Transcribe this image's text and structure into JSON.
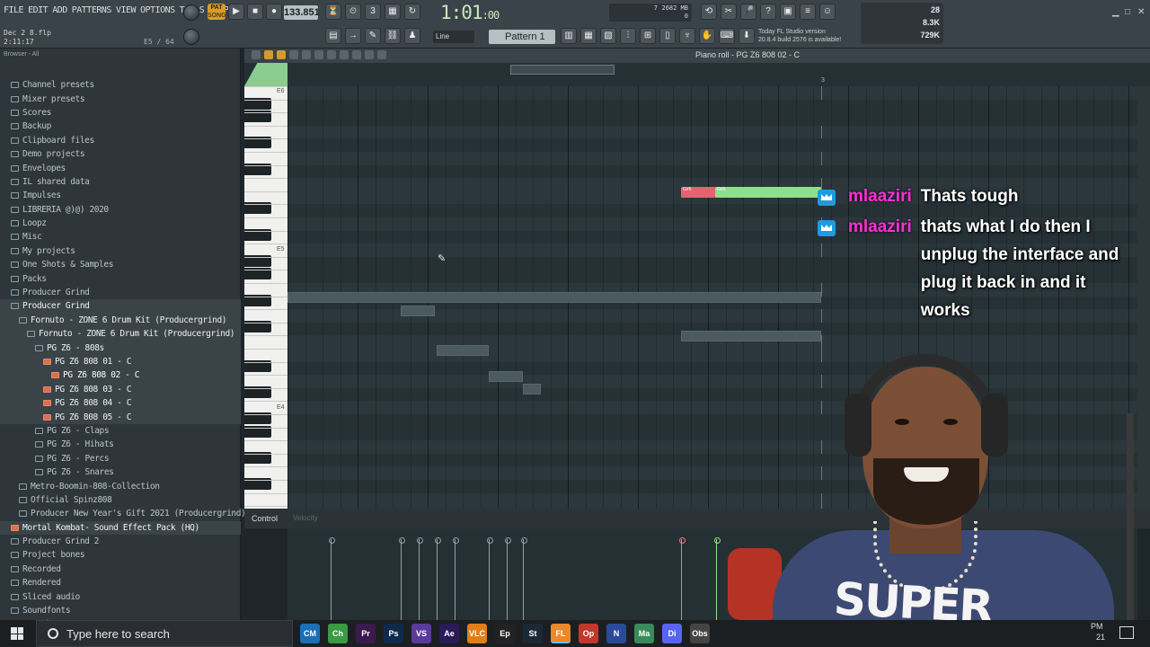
{
  "menu": [
    "FILE",
    "EDIT",
    "ADD",
    "PATTERNS",
    "VIEW",
    "OPTIONS",
    "TOOLS",
    "HELP"
  ],
  "project": {
    "file": "Dec 2 8.flp",
    "time": "2:11:17",
    "hint_pos": "E5 / 64"
  },
  "transport": {
    "pat_label": "PAT",
    "song_label": "SONG",
    "tempo": "133.851",
    "time": "1:01",
    "time_small": ":00",
    "bst_label": "B:S:T"
  },
  "cpu": {
    "value": "7",
    "mem": "2682 MB",
    "poly": "0"
  },
  "snap": {
    "label": "Line"
  },
  "pattern": {
    "label": "Pattern 1"
  },
  "news": {
    "line1": "Today  FL Studio version",
    "line2": "20.8.4 build 2576 is available!"
  },
  "stats": {
    "a": "28",
    "b": "8.3K",
    "c": "729K"
  },
  "browser": {
    "header": "Browser - All",
    "items": [
      {
        "label": "Channel presets",
        "indent": 0,
        "type": "folder"
      },
      {
        "label": "Mixer presets",
        "indent": 0,
        "type": "folder"
      },
      {
        "label": "Scores",
        "indent": 0,
        "type": "folder"
      },
      {
        "label": "Backup",
        "indent": 0,
        "type": "folder"
      },
      {
        "label": "Clipboard files",
        "indent": 0,
        "type": "folder"
      },
      {
        "label": "Demo projects",
        "indent": 0,
        "type": "folder"
      },
      {
        "label": "Envelopes",
        "indent": 0,
        "type": "folder"
      },
      {
        "label": "IL shared data",
        "indent": 0,
        "type": "folder"
      },
      {
        "label": "Impulses",
        "indent": 0,
        "type": "folder"
      },
      {
        "label": "LIBRERIA @)@) 2020",
        "indent": 0,
        "type": "folder"
      },
      {
        "label": "Loopz",
        "indent": 0,
        "type": "folder"
      },
      {
        "label": "Misc",
        "indent": 0,
        "type": "folder"
      },
      {
        "label": "My projects",
        "indent": 0,
        "type": "folder"
      },
      {
        "label": "One Shots & Samples",
        "indent": 0,
        "type": "folder"
      },
      {
        "label": "Packs",
        "indent": 0,
        "type": "folder"
      },
      {
        "label": "Producer Grind",
        "indent": 0,
        "type": "folder"
      },
      {
        "label": "Producer Grind",
        "indent": 0,
        "type": "folder",
        "hl": true
      },
      {
        "label": "Fornuto - ZONE 6 Drum Kit (Producergrind)",
        "indent": 1,
        "type": "folder",
        "hl": true
      },
      {
        "label": "Fornuto - ZONE 6 Drum Kit (Producergrind)",
        "indent": 2,
        "type": "folder",
        "hl": true
      },
      {
        "label": "PG Z6 - 808s",
        "indent": 3,
        "type": "folder",
        "hl": true
      },
      {
        "label": "PG Z6 808 01 - C",
        "indent": 4,
        "type": "file",
        "hl": true
      },
      {
        "label": "PG Z6 808 02 - C",
        "indent": 5,
        "type": "file",
        "hl": true,
        "sel": true
      },
      {
        "label": "PG Z6 808 03 - C",
        "indent": 4,
        "type": "file",
        "hl": true
      },
      {
        "label": "PG Z6 808 04 - C",
        "indent": 4,
        "type": "file",
        "hl": true
      },
      {
        "label": "PG Z6 808 05 - C",
        "indent": 4,
        "type": "file",
        "hl": true
      },
      {
        "label": "PG Z6 - Claps",
        "indent": 3,
        "type": "folder"
      },
      {
        "label": "PG Z6 - Hihats",
        "indent": 3,
        "type": "folder"
      },
      {
        "label": "PG Z6 - Percs",
        "indent": 3,
        "type": "folder"
      },
      {
        "label": "PG Z6 - Snares",
        "indent": 3,
        "type": "folder"
      },
      {
        "label": "Metro-Boomin-808-Collection",
        "indent": 1,
        "type": "folder"
      },
      {
        "label": "Official Spinz808",
        "indent": 1,
        "type": "folder"
      },
      {
        "label": "Producer New Year's Gift 2021 (Producergrind)",
        "indent": 1,
        "type": "folder"
      },
      {
        "label": "Mortal Kombat- Sound Effect Pack (HQ)",
        "indent": 0,
        "type": "file",
        "hl": true
      },
      {
        "label": "Producer Grind 2",
        "indent": 0,
        "type": "folder"
      },
      {
        "label": "Project bones",
        "indent": 0,
        "type": "folder"
      },
      {
        "label": "Recorded",
        "indent": 0,
        "type": "folder"
      },
      {
        "label": "Rendered",
        "indent": 0,
        "type": "folder"
      },
      {
        "label": "Sliced audio",
        "indent": 0,
        "type": "folder"
      },
      {
        "label": "Soundfonts",
        "indent": 0,
        "type": "folder"
      },
      {
        "label": "Speech",
        "indent": 0,
        "type": "folder"
      }
    ]
  },
  "piano_roll": {
    "title": "Piano roll - PG Z6 808 02 - C",
    "octaves": [
      "E6",
      "E5",
      "E4"
    ],
    "ruler_mark": "3",
    "note_labels": [
      "G#5",
      "G#5"
    ],
    "control_label": "Control",
    "control_sub": "Velocity"
  },
  "chat": [
    {
      "user": "mlaaziri",
      "text": "Thats tough"
    },
    {
      "user": "mlaaziri",
      "text": "thats what I do then I unplug the interface and plug it back in and it works"
    }
  ],
  "webcam": {
    "shirt_text": "SUPER"
  },
  "taskbar": {
    "search_placeholder": "Type here to search",
    "apps": [
      "CM",
      "Chrome",
      "Pr",
      "Ps",
      "VS",
      "Ae",
      "VLC",
      "Epic",
      "Steam",
      "FL Studio",
      "Opera",
      "N",
      "Maps",
      "Discord",
      "Obs"
    ],
    "clock": "PM",
    "date_tail": "21"
  },
  "colors": {
    "note_red": "#e0656f",
    "note_green": "#8ce08a",
    "chat_user": "#ff2fd6",
    "accent": "#d99b2b"
  }
}
